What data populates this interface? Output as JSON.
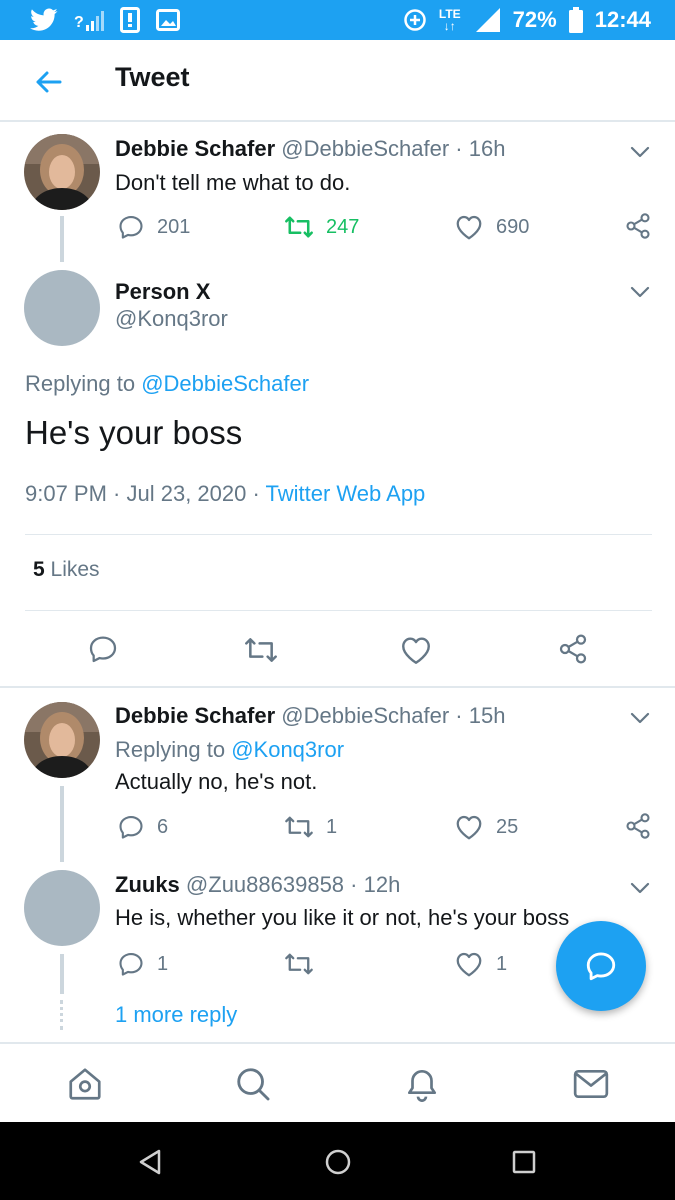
{
  "status_bar": {
    "battery": "72%",
    "time": "12:44",
    "network": "LTE",
    "signal_label": "?",
    "icons": [
      "twitter-icon",
      "signal-icon",
      "sim-icon",
      "image-icon",
      "data-saver-icon",
      "lte-icon",
      "cell-signal-icon",
      "battery-icon"
    ]
  },
  "header": {
    "title": "Tweet"
  },
  "tweets": {
    "t1": {
      "name": "Debbie Schafer",
      "handle": "@DebbieSchafer",
      "time": "16h",
      "text": "Don't tell me what to do.",
      "replies": "201",
      "retweets": "247",
      "likes": "690"
    },
    "main": {
      "name": "Person X",
      "handle": "@Konq3ror",
      "replying_prefix": "Replying to",
      "replying_to": "@DebbieSchafer",
      "text": "He's your boss",
      "timestamp": "9:07 PM · Jul 23, 2020 ·",
      "source": "Twitter Web App",
      "likes_count": "5",
      "likes_label": "Likes"
    },
    "t3": {
      "name": "Debbie Schafer",
      "handle": "@DebbieSchafer",
      "time": "15h",
      "replying_prefix": "Replying to",
      "replying_to": "@Konq3ror",
      "text": "Actually no, he's not.",
      "replies": "6",
      "retweets": "1",
      "likes": "25"
    },
    "t4": {
      "name": "Zuuks",
      "handle": "@Zuu88639858",
      "time": "12h",
      "text": "He is, whether you like it or not, he's your boss",
      "replies": "1",
      "likes": "1",
      "more_replies": "1 more reply"
    }
  },
  "colors": {
    "brand": "#1da1f2",
    "retweet_green": "#17bf63",
    "secondary_text": "#657786",
    "avatar_placeholder": "#aab8c2"
  },
  "tab_bar": {
    "icons": [
      "home-icon",
      "search-icon",
      "notifications-icon",
      "messages-icon"
    ]
  },
  "nav_bar": {
    "icons": [
      "back-nav-icon",
      "home-nav-icon",
      "recents-nav-icon"
    ]
  }
}
